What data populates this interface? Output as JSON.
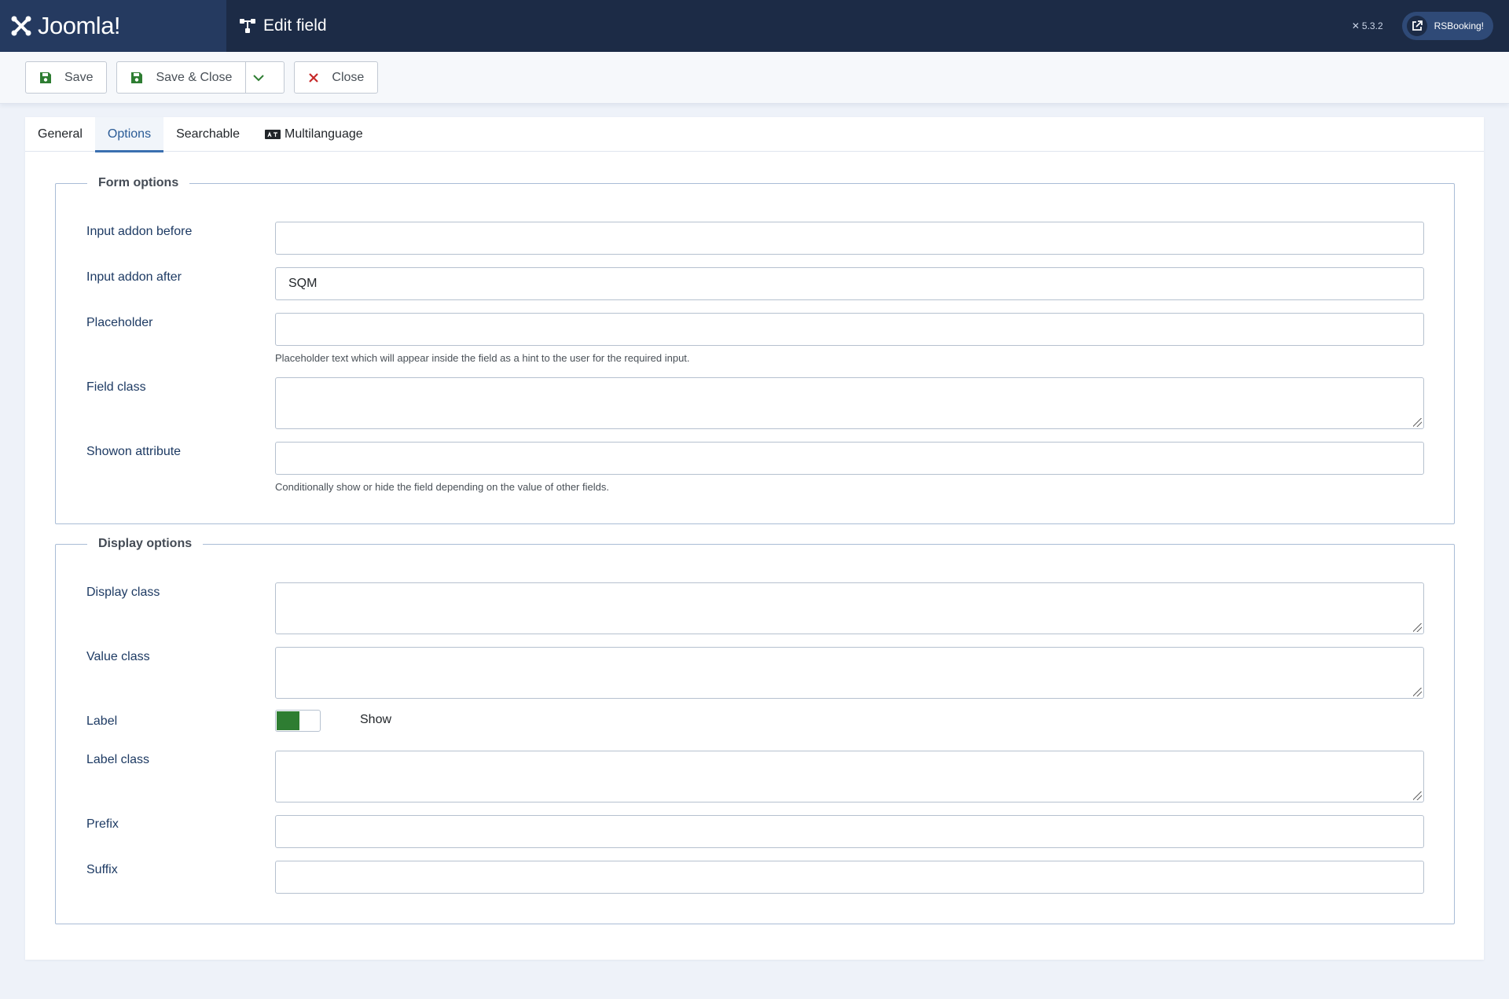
{
  "header": {
    "brand": "Joomla!",
    "page_title": "Edit field",
    "version": "5.3.2",
    "site_button": "RSBooking!"
  },
  "toolbar": {
    "save_label": "Save",
    "save_close_label": "Save & Close",
    "close_label": "Close"
  },
  "tabs": [
    {
      "label": "General",
      "active": false
    },
    {
      "label": "Options",
      "active": true
    },
    {
      "label": "Searchable",
      "active": false
    },
    {
      "label": "Multilanguage",
      "active": false
    }
  ],
  "form_options": {
    "legend": "Form options",
    "input_addon_before": {
      "label": "Input addon before",
      "value": ""
    },
    "input_addon_after": {
      "label": "Input addon after",
      "value": "SQM"
    },
    "placeholder": {
      "label": "Placeholder",
      "value": "",
      "hint": "Placeholder text which will appear inside the field as a hint to the user for the required input."
    },
    "field_class": {
      "label": "Field class",
      "value": ""
    },
    "showon": {
      "label": "Showon attribute",
      "value": "",
      "hint": "Conditionally show or hide the field depending on the value of other fields."
    }
  },
  "display_options": {
    "legend": "Display options",
    "display_class": {
      "label": "Display class",
      "value": ""
    },
    "value_class": {
      "label": "Value class",
      "value": ""
    },
    "label": {
      "label": "Label",
      "state": "Show"
    },
    "label_class": {
      "label": "Label class",
      "value": ""
    },
    "prefix": {
      "label": "Prefix",
      "value": ""
    },
    "suffix": {
      "label": "Suffix",
      "value": ""
    }
  },
  "colors": {
    "header_bg": "#1c2b46",
    "brand_bg": "#253a60",
    "toggle_on": "#2e7d32",
    "save_icon": "#2e7d32",
    "close_icon": "#c62828",
    "tab_active": "#2a5b96"
  }
}
